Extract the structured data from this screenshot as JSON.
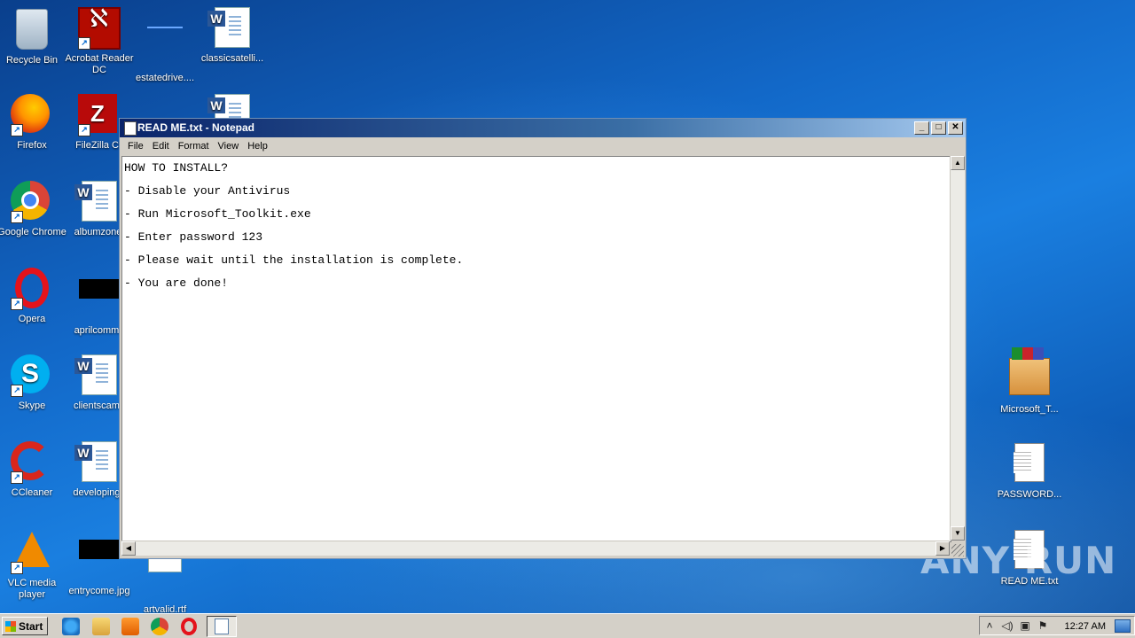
{
  "desktop": {
    "icons": [
      {
        "label": "Recycle Bin"
      },
      {
        "label": "Acrobat Reader DC"
      },
      {
        "label": "estatedrive...."
      },
      {
        "label": "classicsatelli..."
      },
      {
        "label": "Firefox"
      },
      {
        "label": "FileZilla Cli"
      },
      {
        "label": "Google Chrome"
      },
      {
        "label": "albumzone."
      },
      {
        "label": "Opera"
      },
      {
        "label": "aprilcommo"
      },
      {
        "label": "Skype"
      },
      {
        "label": "clientscame"
      },
      {
        "label": "CCleaner"
      },
      {
        "label": "developinga"
      },
      {
        "label": "VLC media player"
      },
      {
        "label": "entrycome.jpg"
      },
      {
        "label": "artvalid.rtf"
      },
      {
        "label": "Microsoft_T..."
      },
      {
        "label": "PASSWORD..."
      },
      {
        "label": "READ ME.txt"
      }
    ]
  },
  "notepad": {
    "title": "READ ME.txt - Notepad",
    "menu": [
      "File",
      "Edit",
      "Format",
      "View",
      "Help"
    ],
    "lines": [
      "HOW TO INSTALL?",
      "- Disable your Antivirus",
      "- Run Microsoft_Toolkit.exe",
      "- Enter password 123",
      "- Please wait until the installation is complete.",
      "- You are done!"
    ]
  },
  "taskbar": {
    "start_label": "Start",
    "clock": "12:27 AM"
  },
  "watermark": "ANY RUN"
}
